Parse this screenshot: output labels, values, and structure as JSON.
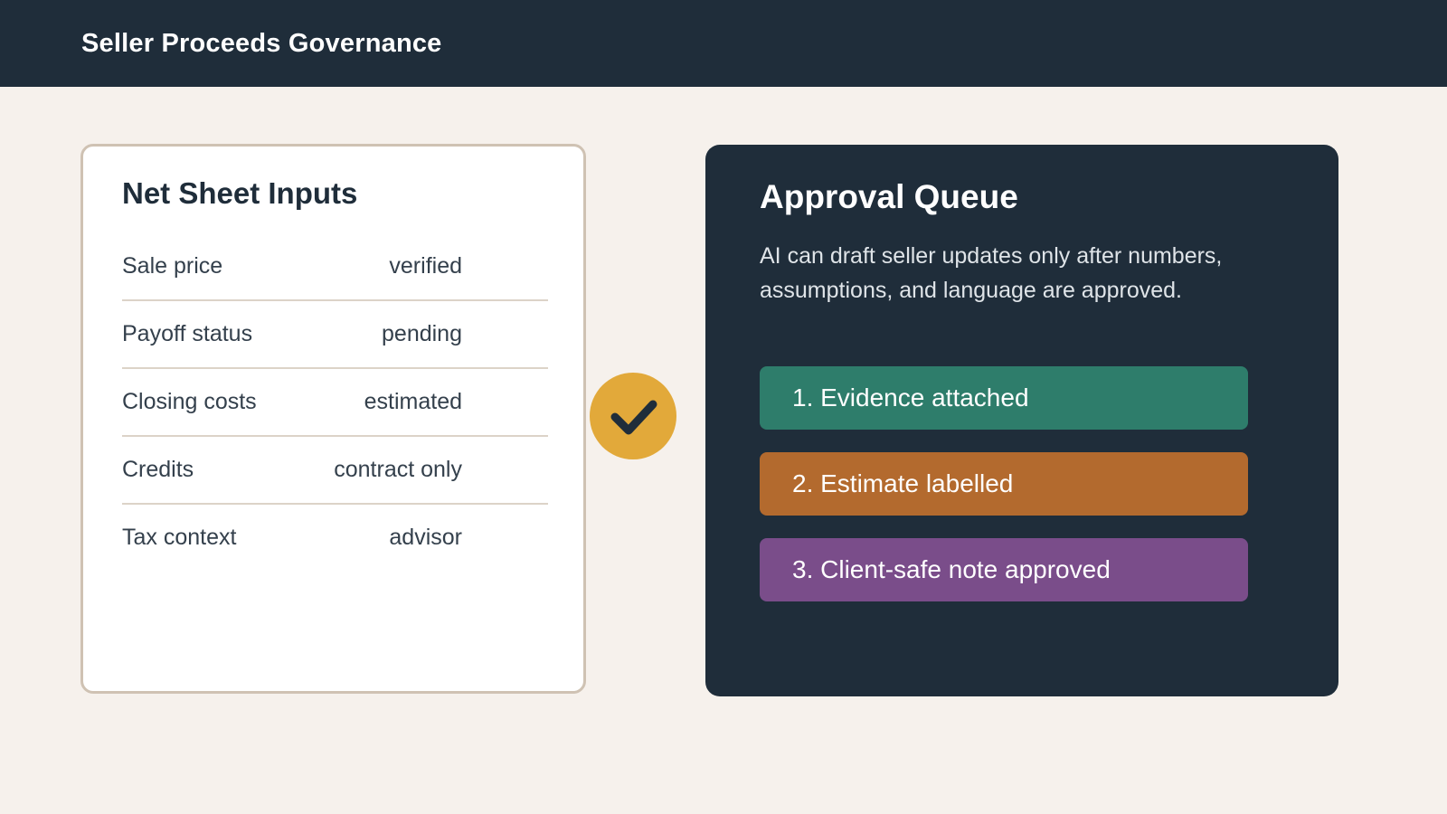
{
  "header": {
    "title": "Seller Proceeds Governance"
  },
  "inputs": {
    "title": "Net Sheet Inputs",
    "rows": [
      {
        "label": "Sale price",
        "value": "verified"
      },
      {
        "label": "Payoff status",
        "value": "pending"
      },
      {
        "label": "Closing costs",
        "value": "estimated"
      },
      {
        "label": "Credits",
        "value": "contract only"
      },
      {
        "label": "Tax context",
        "value": "advisor"
      }
    ]
  },
  "badge": {
    "icon": "checkmark-icon",
    "color": "#e2a93a"
  },
  "queue": {
    "title": "Approval Queue",
    "description": "AI can draft seller updates only after numbers, assumptions, and language are approved.",
    "steps": [
      {
        "label": "1. Evidence attached",
        "color": "#2e7d6b"
      },
      {
        "label": "2. Estimate labelled",
        "color": "#b36a2e"
      },
      {
        "label": "3. Client-safe note approved",
        "color": "#7a4d8a"
      }
    ]
  }
}
